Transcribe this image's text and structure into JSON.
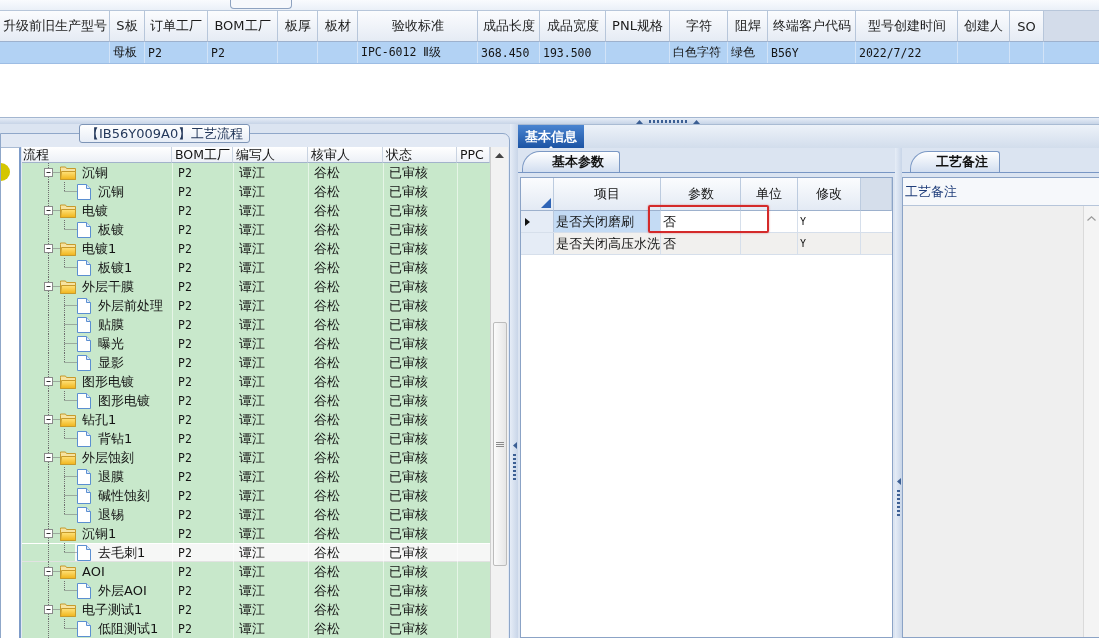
{
  "order_table": {
    "columns": [
      "升级前旧生产型号",
      "S板",
      "订单工厂",
      "BOM工厂",
      "板厚",
      "板材",
      "验收标准",
      "成品长度",
      "成品宽度",
      "PNL规格",
      "字符",
      "阻焊",
      "终端客户代码",
      "型号创建时间",
      "创建人",
      "SO"
    ],
    "rows": [
      {
        "selected": true,
        "cells": [
          null,
          "母板",
          "P2",
          "P2",
          null,
          null,
          "IPC-6012 Ⅱ级",
          "368.450",
          "193.500",
          null,
          "白色字符",
          "绿色",
          "B56Y",
          "2022/7/22",
          null,
          null
        ]
      }
    ]
  },
  "process_panel": {
    "title": "【IB56Y009A0】工艺流程",
    "columns": [
      "流程",
      "BOM工厂",
      "编写人",
      "核审人",
      "状态",
      "PPC"
    ],
    "rows": [
      {
        "cells": [
          "沉铜",
          "P2",
          "谭江",
          "谷松",
          "已审核"
        ],
        "selected": false,
        "expanded": true,
        "children": [
          {
            "cells": [
              "沉铜",
              "P2",
              "谭江",
              "谷松",
              "已审核"
            ],
            "selected": false
          }
        ]
      },
      {
        "cells": [
          "电镀",
          "P2",
          "谭江",
          "谷松",
          "已审核"
        ],
        "selected": false,
        "expanded": true,
        "children": [
          {
            "cells": [
              "板镀",
              "P2",
              "谭江",
              "谷松",
              "已审核"
            ],
            "selected": false
          }
        ]
      },
      {
        "cells": [
          "电镀1",
          "P2",
          "谭江",
          "谷松",
          "已审核"
        ],
        "selected": false,
        "expanded": true,
        "children": [
          {
            "cells": [
              "板镀1",
              "P2",
              "谭江",
              "谷松",
              "已审核"
            ],
            "selected": false
          }
        ]
      },
      {
        "cells": [
          "外层干膜",
          "P2",
          "谭江",
          "谷松",
          "已审核"
        ],
        "selected": false,
        "expanded": true,
        "children": [
          {
            "cells": [
              "外层前处理",
              "P2",
              "谭江",
              "谷松",
              "已审核"
            ],
            "selected": false
          },
          {
            "cells": [
              "贴膜",
              "P2",
              "谭江",
              "谷松",
              "已审核"
            ],
            "selected": false
          },
          {
            "cells": [
              "曝光",
              "P2",
              "谭江",
              "谷松",
              "已审核"
            ],
            "selected": false
          },
          {
            "cells": [
              "显影",
              "P2",
              "谭江",
              "谷松",
              "已审核"
            ],
            "selected": false
          }
        ]
      },
      {
        "cells": [
          "图形电镀",
          "P2",
          "谭江",
          "谷松",
          "已审核"
        ],
        "selected": false,
        "expanded": true,
        "children": [
          {
            "cells": [
              "图形电镀",
              "P2",
              "谭江",
              "谷松",
              "已审核"
            ],
            "selected": false
          }
        ]
      },
      {
        "cells": [
          "钻孔1",
          "P2",
          "谭江",
          "谷松",
          "已审核"
        ],
        "selected": false,
        "expanded": true,
        "children": [
          {
            "cells": [
              "背钻1",
              "P2",
              "谭江",
              "谷松",
              "已审核"
            ],
            "selected": false
          }
        ]
      },
      {
        "cells": [
          "外层蚀刻",
          "P2",
          "谭江",
          "谷松",
          "已审核"
        ],
        "selected": false,
        "expanded": true,
        "children": [
          {
            "cells": [
              "退膜",
              "P2",
              "谭江",
              "谷松",
              "已审核"
            ],
            "selected": false
          },
          {
            "cells": [
              "碱性蚀刻",
              "P2",
              "谭江",
              "谷松",
              "已审核"
            ],
            "selected": false
          },
          {
            "cells": [
              "退锡",
              "P2",
              "谭江",
              "谷松",
              "已审核"
            ],
            "selected": false
          }
        ]
      },
      {
        "cells": [
          "沉铜1",
          "P2",
          "谭江",
          "谷松",
          "已审核"
        ],
        "selected": false,
        "expanded": true,
        "children": [
          {
            "cells": [
              "去毛刺1",
              "P2",
              "谭江",
              "谷松",
              "已审核"
            ],
            "selected": true
          }
        ]
      },
      {
        "cells": [
          "AOI",
          "P2",
          "谭江",
          "谷松",
          "已审核"
        ],
        "selected": false,
        "expanded": true,
        "children": [
          {
            "cells": [
              "外层AOI",
              "P2",
              "谭江",
              "谷松",
              "已审核"
            ],
            "selected": false
          }
        ]
      },
      {
        "cells": [
          "电子测试1",
          "P2",
          "谭江",
          "谷松",
          "已审核"
        ],
        "selected": false,
        "expanded": true,
        "children": [
          {
            "cells": [
              "低阻测试1",
              "P2",
              "谭江",
              "谷松",
              "已审核"
            ],
            "selected": false
          }
        ]
      }
    ]
  },
  "detail_tabs": [
    {
      "label": "基本信息",
      "selected": true
    }
  ],
  "params_panel": {
    "tab": {
      "label": "基本参数",
      "selected": true
    },
    "columns": [
      "项目",
      "参数",
      "单位",
      "修改"
    ],
    "rows": [
      {
        "selected": true,
        "highlighted": true,
        "cells": [
          "是否关闭磨刷",
          "否",
          null,
          "Y"
        ]
      },
      {
        "selected": false,
        "highlighted": false,
        "cells": [
          "是否关闭高压水洗",
          "否",
          null,
          "Y"
        ]
      }
    ]
  },
  "notes_panel": {
    "tab": {
      "label": "工艺备注",
      "selected": true
    },
    "label": "工艺备注"
  }
}
